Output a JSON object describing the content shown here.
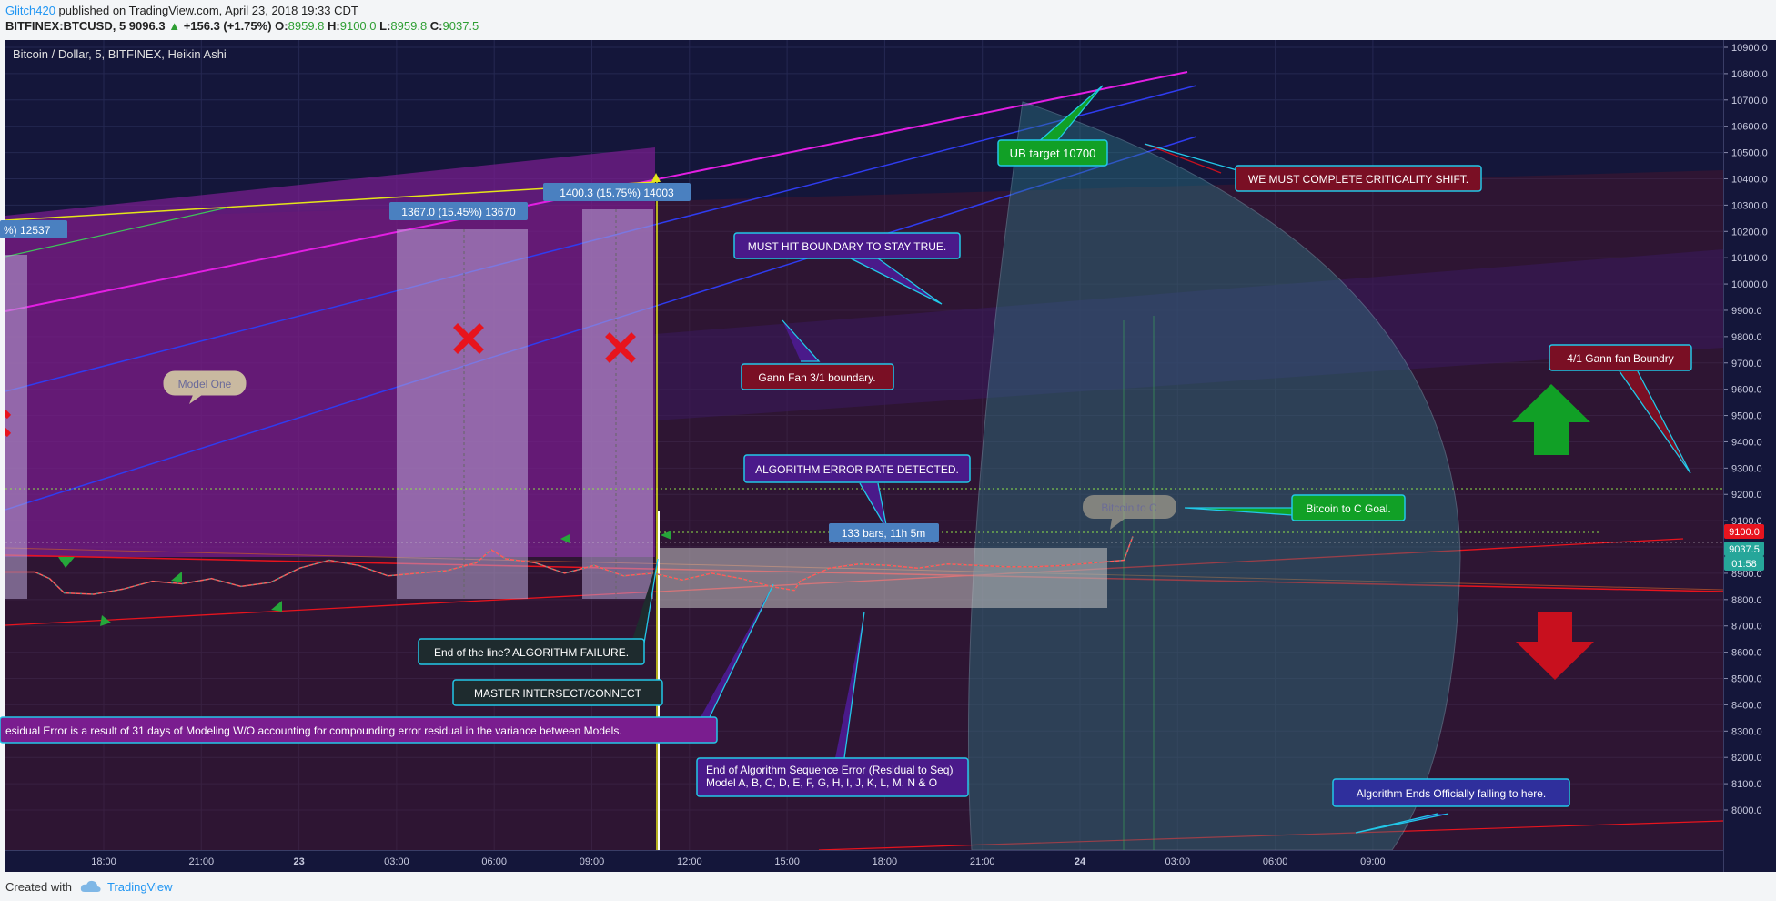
{
  "header": {
    "author": "Glitch420",
    "published": "published on TradingView.com, April 23, 2018 19:33 CDT",
    "symbol": "BITFINEX:BTCUSD, 5",
    "last": "9096.3",
    "change_arrow": "▲",
    "change": "+156.3 (+1.75%)",
    "o_label": "O:",
    "o_value": "8959.8",
    "h_label": "H:",
    "h_value": "9100.0",
    "l_label": "L:",
    "l_value": "8959.8",
    "c_label": "C:",
    "c_value": "9037.5"
  },
  "colors": {
    "background": "#14163a",
    "purple_zone": "#7a1d8f",
    "maroon_zone": "#4a1426",
    "up_candle": "#26a69a",
    "down_candle": "#ef5350",
    "magenta_line": "#e31ee3",
    "accent_green": "#11a026",
    "accent_red": "#c8101e"
  },
  "chart_data": {
    "type": "candlestick",
    "title": "Bitcoin / Dollar, 5, BITFINEX, Heikin Ashi",
    "x_ticks": [
      "18:00",
      "21:00",
      "23",
      "03:00",
      "06:00",
      "09:00",
      "12:00",
      "15:00",
      "18:00",
      "21:00",
      "24",
      "03:00",
      "06:00",
      "09:00"
    ],
    "y_ticks": [
      "10900.0",
      "10800.0",
      "10700.0",
      "10600.0",
      "10500.0",
      "10400.0",
      "10300.0",
      "10200.0",
      "10100.0",
      "10000.0",
      "9900.0",
      "9800.0",
      "9700.0",
      "9600.0",
      "9500.0",
      "9400.0",
      "9300.0",
      "9200.0",
      "9100.0",
      "9000.0",
      "8900.0",
      "8800.0",
      "8700.0",
      "8600.0",
      "8500.0",
      "8400.0",
      "8300.0",
      "8200.0",
      "8100.0",
      "8000.0"
    ],
    "ylim": [
      7950,
      10920
    ],
    "price_labels": {
      "high": "9100.0",
      "last": "9037.5",
      "countdown": "01:58"
    },
    "price_series": {
      "x": [
        0,
        1,
        1.5,
        2,
        3,
        4,
        5,
        6,
        7,
        8,
        9,
        10,
        11,
        12,
        13,
        14,
        15,
        16,
        16.5,
        17,
        18,
        19,
        20,
        21,
        22,
        23,
        24,
        25,
        26,
        26.8,
        27,
        28,
        29,
        30,
        31,
        32,
        33,
        34,
        35,
        36,
        37,
        38,
        38.3
      ],
      "y": [
        8905,
        8905,
        8880,
        8825,
        8820,
        8840,
        8870,
        8860,
        8880,
        8850,
        8865,
        8920,
        8950,
        8930,
        8890,
        8900,
        8910,
        8940,
        8990,
        8955,
        8940,
        8900,
        8930,
        8890,
        8900,
        8875,
        8900,
        8880,
        8850,
        8835,
        8870,
        8920,
        8935,
        8930,
        8920,
        8935,
        8930,
        8925,
        8925,
        8930,
        8940,
        8950,
        9040
      ]
    },
    "measurements": [
      {
        "label": "%) 12537"
      },
      {
        "label": "1367.0 (15.45%) 13670"
      },
      {
        "label": "1400.3 (15.75%) 14003"
      },
      {
        "label": "133 bars, 11h 5m"
      }
    ],
    "annotations": [
      {
        "id": "model_one",
        "text": "Model One"
      },
      {
        "id": "ub_target",
        "text": "UB target 10700"
      },
      {
        "id": "criticality",
        "text": "WE MUST COMPLETE CRITICALITY SHIFT."
      },
      {
        "id": "must_hit",
        "text": "MUST HIT BOUNDARY TO STAY TRUE."
      },
      {
        "id": "gann_31",
        "text": "Gann Fan 3/1 boundary."
      },
      {
        "id": "gann_41",
        "text": "4/1 Gann fan Boundry"
      },
      {
        "id": "algo_error",
        "text": "ALGORITHM ERROR RATE DETECTED."
      },
      {
        "id": "bitcoin_c_ghost",
        "text": "Bitcoin to C"
      },
      {
        "id": "bitcoin_c_goal",
        "text": "Bitcoin to C Goal."
      },
      {
        "id": "end_line",
        "text": "End of the line? ALGORITHM FAILURE."
      },
      {
        "id": "master",
        "text": "MASTER INTERSECT/CONNECT"
      },
      {
        "id": "residual",
        "text": "esidual Error is a result of 31 days of Modeling W/O accounting for compounding error residual in the variance between Models."
      },
      {
        "id": "end_seq_1",
        "text": "End of Algorithm Sequence  Error (Residual to Seq)"
      },
      {
        "id": "end_seq_2",
        "text": "Model A, B, C, D, E, F, G, H, I, J, K, L, M, N & O"
      },
      {
        "id": "algo_ends",
        "text": "Algorithm Ends Officially falling to here."
      }
    ]
  },
  "footer": {
    "created_with": "Created with",
    "brand": "TradingView"
  }
}
